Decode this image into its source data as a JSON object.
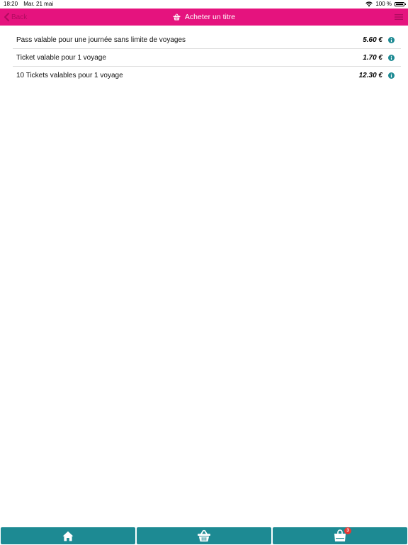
{
  "status_bar": {
    "time": "18:20",
    "date": "Mar. 21 mai",
    "battery": "100 %"
  },
  "header": {
    "back_label": "Back",
    "title": "Acheter un titre"
  },
  "tickets": [
    {
      "label": "Pass valable pour une journée sans limite de voyages",
      "price": "5.60 €"
    },
    {
      "label": "Ticket valable pour 1 voyage",
      "price": "1.70 €"
    },
    {
      "label": "10 Tickets valables pour 1 voyage",
      "price": "12.30 €"
    }
  ],
  "tab_bar": {
    "tabs": [
      {
        "icon": "home-icon"
      },
      {
        "icon": "basket-icon"
      },
      {
        "icon": "shopping-bag-icon",
        "badge": "3"
      }
    ]
  },
  "colors": {
    "header_bg": "#e5137e",
    "tab_bg": "#1d8a93",
    "info_icon": "#1d8a93",
    "badge": "#e53935"
  }
}
